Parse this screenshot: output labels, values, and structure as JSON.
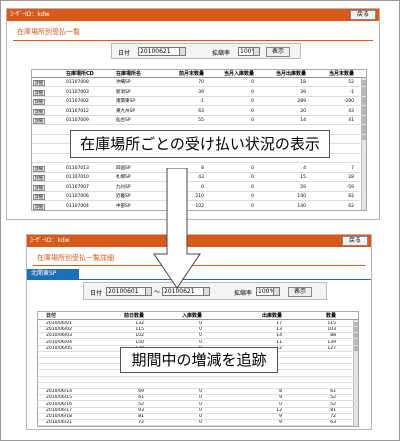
{
  "top": {
    "titlebar_text": "ﾕｰｻﾞｰID：kdw",
    "return_label": "戻る",
    "page_title": "在庫場所別受払一覧",
    "date_label": "日付",
    "date_value": "20100621",
    "zoom_label": "拡縮率",
    "zoom_value": "100%",
    "display_label": "表示",
    "columns": [
      "在庫場所CD",
      "在庫場所名",
      "前月末数量",
      "当月入庫数量",
      "当月出庫数量",
      "当月末数量"
    ],
    "detail_label": "詳細",
    "rows": [
      [
        "01107008",
        "沖縄SP",
        "70",
        "0",
        "18",
        "52"
      ],
      [
        "01107003",
        "新潟SP",
        "39",
        "0",
        "39",
        "-1"
      ],
      [
        "01107002",
        "南関東SP",
        "-1",
        "0",
        "289",
        "-290"
      ],
      [
        "01107012",
        "東九州SP",
        "63",
        "0",
        "20",
        "43"
      ],
      [
        "01107009",
        "仙台SP",
        "55",
        "0",
        "14",
        "41"
      ],
      [
        "",
        "",
        "",
        "",
        "",
        ""
      ],
      [
        "",
        "",
        "",
        "",
        "",
        ""
      ],
      [
        "",
        "",
        "",
        "",
        "",
        ""
      ],
      [
        "",
        "",
        "",
        "",
        "",
        ""
      ],
      [
        "01107013",
        "四国SP",
        "8",
        "0",
        "4",
        "7"
      ],
      [
        "01107010",
        "札幌SP",
        "43",
        "0",
        "15",
        "28"
      ],
      [
        "01107007",
        "九州SP",
        "0",
        "0",
        "59",
        "-59"
      ],
      [
        "01107006",
        "近畿SP",
        "210",
        "0",
        "140",
        "82"
      ],
      [
        "01107004",
        "中部SP",
        "102",
        "0",
        "140",
        "62"
      ]
    ]
  },
  "bottom": {
    "titlebar_text": "ﾕｰｻﾞｰID：kdw",
    "return_label": "戻る",
    "page_title": "在庫場所別受払一覧詳細",
    "tab_label": "北関東SP",
    "date_label": "日付",
    "date_from": "20100601",
    "date_sep": "～",
    "date_to": "20100621",
    "zoom_label": "拡縮率",
    "zoom_value": "100%",
    "display_label": "表示",
    "columns": [
      "日付",
      "前日数量",
      "入庫数量",
      "出庫数量",
      "数量"
    ],
    "rows": [
      [
        "2010/06/01",
        "132",
        "0",
        "17",
        "115"
      ],
      [
        "2010/06/02",
        "115",
        "0",
        "13",
        "103"
      ],
      [
        "2010/06/03",
        "102",
        "0",
        "14",
        "88"
      ],
      [
        "2010/06/04",
        "150",
        "0",
        "11",
        "139"
      ],
      [
        "2010/06/05",
        "139",
        "0",
        "12",
        "127"
      ],
      [
        "",
        "",
        "",
        "",
        ""
      ],
      [
        "",
        "",
        "",
        "",
        ""
      ],
      [
        "",
        "",
        "",
        "",
        ""
      ],
      [
        "",
        "",
        "",
        "",
        ""
      ],
      [
        "",
        "",
        "",
        "",
        ""
      ],
      [
        "",
        "",
        "",
        "",
        ""
      ],
      [
        "2010/06/14",
        "69",
        "0",
        "8",
        "61"
      ],
      [
        "2010/06/15",
        "61",
        "0",
        "9",
        "52"
      ],
      [
        "2010/06/16",
        "52",
        "0",
        "0",
        "52"
      ],
      [
        "2010/06/17",
        "93",
        "0",
        "12",
        "81"
      ],
      [
        "2010/06/18",
        "81",
        "0",
        "9",
        "72"
      ],
      [
        "2010/06/21",
        "72",
        "0",
        "9",
        "63"
      ]
    ]
  },
  "annotations": {
    "top_caption": "在庫場所ごとの受け払い状況の表示",
    "bottom_caption": "期間中の増減を追跡"
  }
}
